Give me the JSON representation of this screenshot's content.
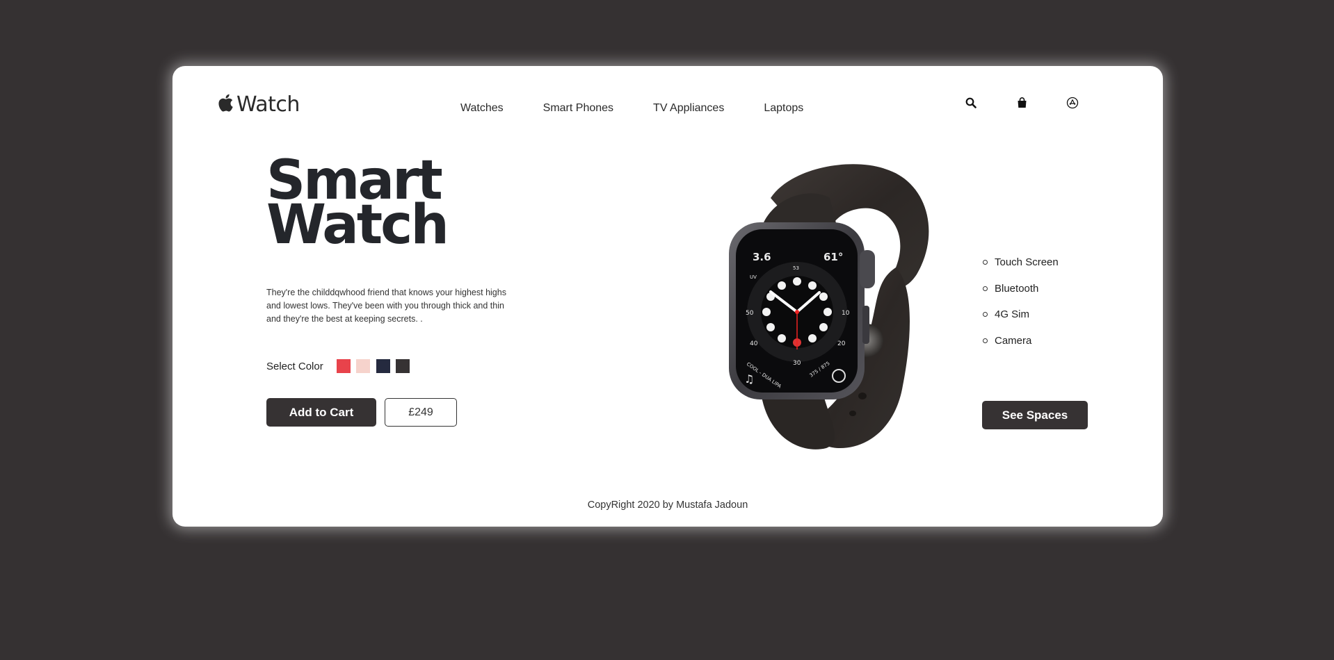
{
  "brand": {
    "logo_text": "Watch",
    "logo_icon": "apple-icon"
  },
  "nav": {
    "items": [
      "Watches",
      "Smart Phones",
      "TV Appliances",
      "Laptops"
    ]
  },
  "header_icons": [
    "search-icon",
    "shopping-bag-icon",
    "app-store-icon"
  ],
  "hero": {
    "title_line1": "Smart",
    "title_line2": "Watch",
    "description": "They're the childdqwhood friend that knows your highest highs and lowest lows. They've been with you through thick and thin and they're the best at keeping secrets. .",
    "select_color_label": "Select Color",
    "colors": [
      "#e8434b",
      "#f6d3cc",
      "#252a3f",
      "#363233"
    ],
    "add_to_cart_label": "Add to Cart",
    "price": "£249"
  },
  "watch_face": {
    "top_left": "3.6",
    "top_right": "61°",
    "left_num": "50",
    "right_num": "10",
    "lower_left": "40",
    "lower_right": "20",
    "bottom": "30",
    "bottom_left_text": "COOL - DUA LIPA",
    "bottom_right_text": "375 / 875",
    "top_mid": "53",
    "uv": "UV"
  },
  "features": [
    "Touch Screen",
    "Bluetooth",
    "4G Sim",
    "Camera"
  ],
  "see_specs_label": "See Spaces",
  "footer": "CopyRight 2020 by Mustafa Jadoun"
}
